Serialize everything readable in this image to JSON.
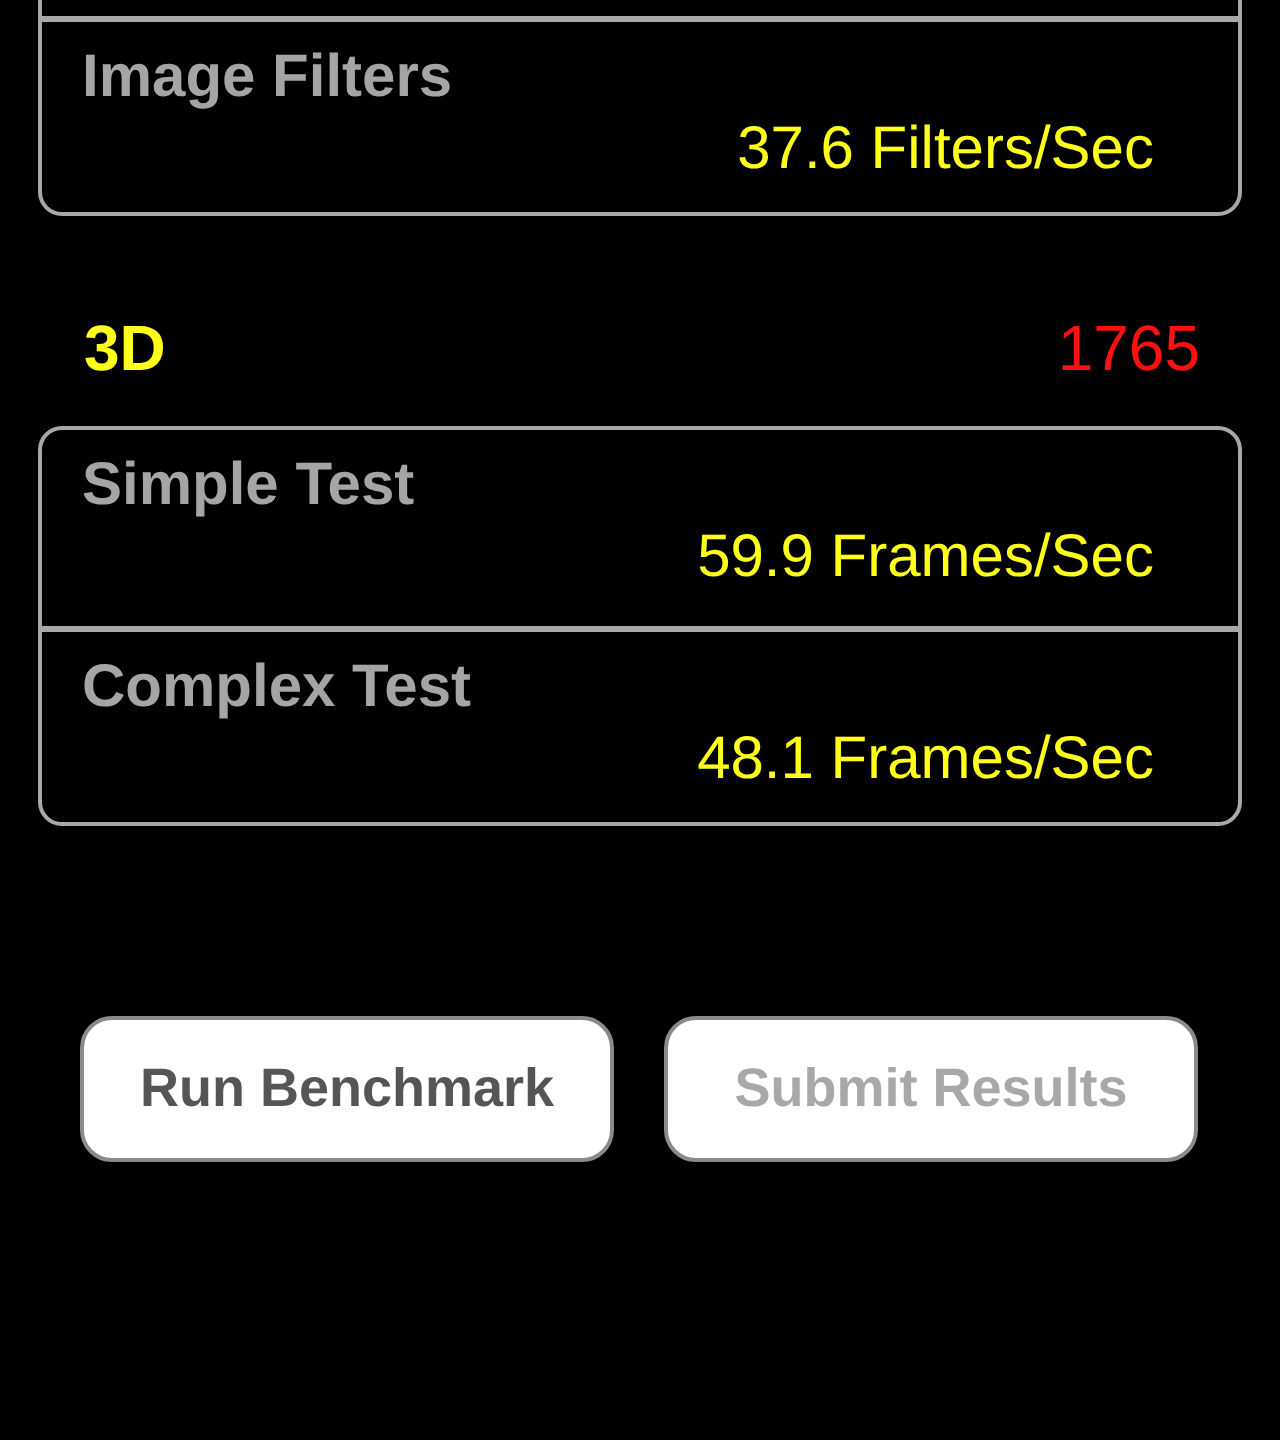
{
  "groups": [
    {
      "kind": "continued",
      "rows": [
        {
          "name": "Image Filters",
          "result": "37.6 Filters/Sec"
        }
      ]
    },
    {
      "kind": "full",
      "title": "3D",
      "score": "1765",
      "rows": [
        {
          "name": "Simple Test",
          "result": "59.9 Frames/Sec"
        },
        {
          "name": "Complex Test",
          "result": "48.1 Frames/Sec"
        }
      ]
    }
  ],
  "buttons": [
    {
      "label": "Run Benchmark",
      "disabled": false
    },
    {
      "label": "Submit Results",
      "disabled": true
    }
  ]
}
